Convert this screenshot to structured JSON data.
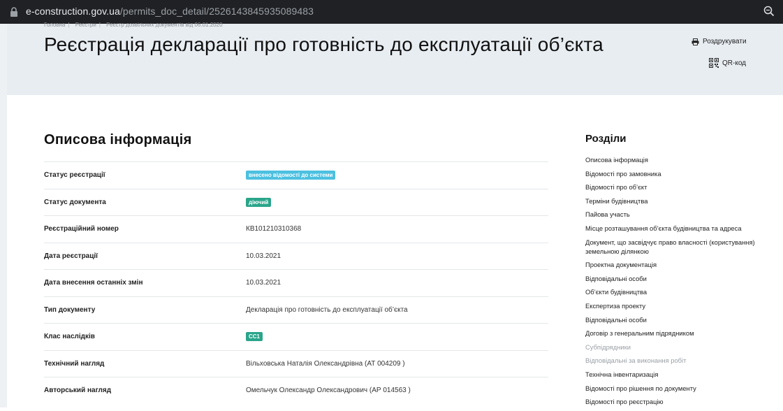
{
  "browser": {
    "url_host": "e-construction.gov.ua",
    "url_path": "/permits_doc_detail/2526143845935089483"
  },
  "breadcrumb": [
    "Головна",
    "Реєстри",
    "Реєстр дозвільних документів від 06.01.2020"
  ],
  "header": {
    "title": "Реєстрація декларації про готовність до експлуатації об’єкта",
    "print_label": "Роздрукувати",
    "qr_label": "QR-код"
  },
  "main": {
    "section_title": "Описова інформація",
    "rows": [
      {
        "label": "Статус реєстрації",
        "value": "внесено відомості до системи",
        "type": "badge",
        "color": "#4cc0e0"
      },
      {
        "label": "Статус документа",
        "value": "діючий",
        "type": "badge",
        "color": "#2aa58a"
      },
      {
        "label": "Реєстраційний номер",
        "value": "КВ101210310368",
        "type": "text"
      },
      {
        "label": "Дата реєстрації",
        "value": "10.03.2021",
        "type": "text"
      },
      {
        "label": "Дата внесення останніх змін",
        "value": "10.03.2021",
        "type": "text"
      },
      {
        "label": "Тип документу",
        "value": "Декларація про готовність до експлуатації об’єкта",
        "type": "text"
      },
      {
        "label": "Клас наслідків",
        "value": "СС1",
        "type": "badge",
        "color": "#2aa58a"
      },
      {
        "label": "Технічний нагляд",
        "value": "Вільховська Наталія Олександрівна (АТ 004209 )",
        "type": "text"
      },
      {
        "label": "Авторський нагляд",
        "value": "Омельчук Олександр Олександрович (АР 014563 )",
        "type": "text"
      }
    ]
  },
  "sidebar": {
    "title": "Розділи",
    "items": [
      {
        "label": "Описова інформація",
        "muted": false
      },
      {
        "label": "Відомості про замовника",
        "muted": false
      },
      {
        "label": "Відомості про об’єкт",
        "muted": false
      },
      {
        "label": "Терміни будівництва",
        "muted": false
      },
      {
        "label": "Пайова участь",
        "muted": false
      },
      {
        "label": "Місце розташування об’єкта будівництва та адреса",
        "muted": false
      },
      {
        "label": "Документ, що засвідчує право власності (користування) земельною ділянкою",
        "muted": false
      },
      {
        "label": "Проектна документація",
        "muted": false
      },
      {
        "label": "Відповідальні особи",
        "muted": false
      },
      {
        "label": "Об’єкти будівництва",
        "muted": false
      },
      {
        "label": "Експертиза проекту",
        "muted": false
      },
      {
        "label": "Відповідальні особи",
        "muted": false
      },
      {
        "label": "Договір з генеральним підрядником",
        "muted": false
      },
      {
        "label": "Субпідрядники",
        "muted": true
      },
      {
        "label": "Відповідальні за виконання робіт",
        "muted": true
      },
      {
        "label": "Технічна інвентаризація",
        "muted": false
      },
      {
        "label": "Відомості про рішення по документу",
        "muted": false
      },
      {
        "label": "Відомості про реєстрацію",
        "muted": false
      }
    ]
  }
}
